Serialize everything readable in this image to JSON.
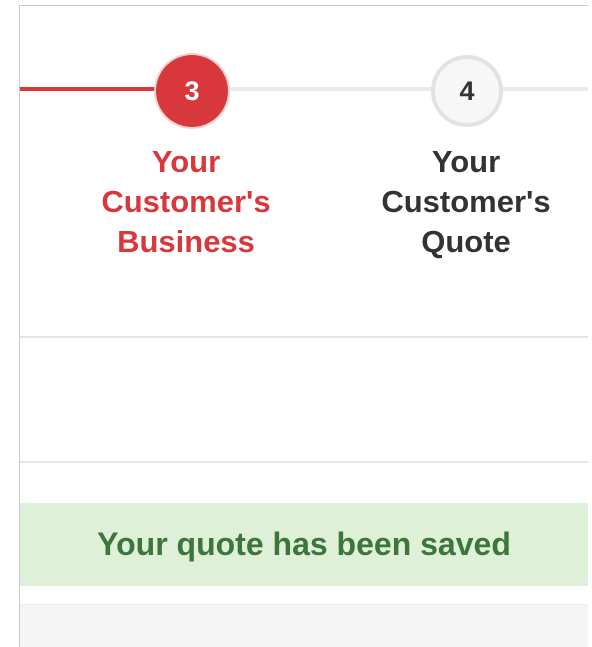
{
  "stepper": {
    "steps": [
      {
        "number": "3",
        "label_lines": [
          "Your",
          "Customer's",
          "Business"
        ],
        "state": "active"
      },
      {
        "number": "4",
        "label_lines": [
          "Your",
          "Customer's",
          "Quote"
        ],
        "state": "pending"
      }
    ]
  },
  "alert": {
    "message": "Your quote has been saved",
    "status": "success"
  },
  "colors": {
    "active": "#d8383c",
    "pending_text": "#333333",
    "success_bg": "#dff0d8",
    "success_text": "#3c763d"
  }
}
